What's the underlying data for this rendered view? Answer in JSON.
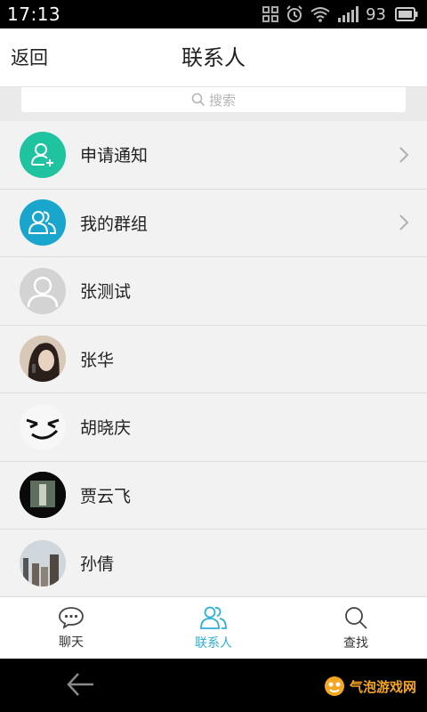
{
  "status": {
    "time": "17:13",
    "battery": "93"
  },
  "nav": {
    "back_label": "返回",
    "title": "联系人"
  },
  "search": {
    "placeholder": "搜索"
  },
  "contacts": [
    {
      "label": "申请通知",
      "avatar": "add-user-icon",
      "color": "#1fc3a0",
      "chevron": true
    },
    {
      "label": "我的群组",
      "avatar": "group-icon",
      "color": "#1aa6cc",
      "chevron": true
    },
    {
      "label": "张测试",
      "avatar": "default-avatar-icon",
      "color": "#d5d5d5",
      "chevron": false
    },
    {
      "label": "张华",
      "avatar": "photo-avatar",
      "chevron": false
    },
    {
      "label": "胡晓庆",
      "avatar": "smiley-avatar",
      "chevron": false
    },
    {
      "label": "贾云飞",
      "avatar": "photo-avatar",
      "chevron": false
    },
    {
      "label": "孙倩",
      "avatar": "photo-avatar",
      "chevron": false
    }
  ],
  "tabs": [
    {
      "label": "聊天",
      "icon": "chat-bubble-icon",
      "active": false
    },
    {
      "label": "联系人",
      "icon": "contacts-icon",
      "active": true
    },
    {
      "label": "查找",
      "icon": "search-icon",
      "active": false
    }
  ],
  "watermark": {
    "text": "气泡游戏网"
  },
  "colors": {
    "accent": "#2bb0d6",
    "notify": "#1fc3a0",
    "group": "#1aa6cc"
  }
}
